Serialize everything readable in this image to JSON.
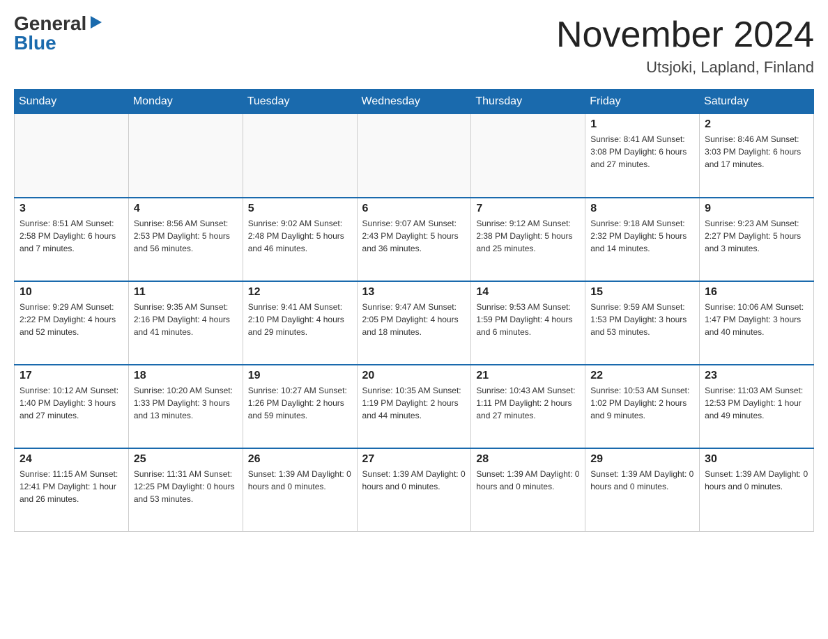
{
  "logo": {
    "general": "General",
    "blue": "Blue"
  },
  "header": {
    "month": "November 2024",
    "location": "Utsjoki, Lapland, Finland"
  },
  "days_of_week": [
    "Sunday",
    "Monday",
    "Tuesday",
    "Wednesday",
    "Thursday",
    "Friday",
    "Saturday"
  ],
  "weeks": [
    [
      {
        "day": "",
        "info": ""
      },
      {
        "day": "",
        "info": ""
      },
      {
        "day": "",
        "info": ""
      },
      {
        "day": "",
        "info": ""
      },
      {
        "day": "",
        "info": ""
      },
      {
        "day": "1",
        "info": "Sunrise: 8:41 AM\nSunset: 3:08 PM\nDaylight: 6 hours and 27 minutes."
      },
      {
        "day": "2",
        "info": "Sunrise: 8:46 AM\nSunset: 3:03 PM\nDaylight: 6 hours and 17 minutes."
      }
    ],
    [
      {
        "day": "3",
        "info": "Sunrise: 8:51 AM\nSunset: 2:58 PM\nDaylight: 6 hours and 7 minutes."
      },
      {
        "day": "4",
        "info": "Sunrise: 8:56 AM\nSunset: 2:53 PM\nDaylight: 5 hours and 56 minutes."
      },
      {
        "day": "5",
        "info": "Sunrise: 9:02 AM\nSunset: 2:48 PM\nDaylight: 5 hours and 46 minutes."
      },
      {
        "day": "6",
        "info": "Sunrise: 9:07 AM\nSunset: 2:43 PM\nDaylight: 5 hours and 36 minutes."
      },
      {
        "day": "7",
        "info": "Sunrise: 9:12 AM\nSunset: 2:38 PM\nDaylight: 5 hours and 25 minutes."
      },
      {
        "day": "8",
        "info": "Sunrise: 9:18 AM\nSunset: 2:32 PM\nDaylight: 5 hours and 14 minutes."
      },
      {
        "day": "9",
        "info": "Sunrise: 9:23 AM\nSunset: 2:27 PM\nDaylight: 5 hours and 3 minutes."
      }
    ],
    [
      {
        "day": "10",
        "info": "Sunrise: 9:29 AM\nSunset: 2:22 PM\nDaylight: 4 hours and 52 minutes."
      },
      {
        "day": "11",
        "info": "Sunrise: 9:35 AM\nSunset: 2:16 PM\nDaylight: 4 hours and 41 minutes."
      },
      {
        "day": "12",
        "info": "Sunrise: 9:41 AM\nSunset: 2:10 PM\nDaylight: 4 hours and 29 minutes."
      },
      {
        "day": "13",
        "info": "Sunrise: 9:47 AM\nSunset: 2:05 PM\nDaylight: 4 hours and 18 minutes."
      },
      {
        "day": "14",
        "info": "Sunrise: 9:53 AM\nSunset: 1:59 PM\nDaylight: 4 hours and 6 minutes."
      },
      {
        "day": "15",
        "info": "Sunrise: 9:59 AM\nSunset: 1:53 PM\nDaylight: 3 hours and 53 minutes."
      },
      {
        "day": "16",
        "info": "Sunrise: 10:06 AM\nSunset: 1:47 PM\nDaylight: 3 hours and 40 minutes."
      }
    ],
    [
      {
        "day": "17",
        "info": "Sunrise: 10:12 AM\nSunset: 1:40 PM\nDaylight: 3 hours and 27 minutes."
      },
      {
        "day": "18",
        "info": "Sunrise: 10:20 AM\nSunset: 1:33 PM\nDaylight: 3 hours and 13 minutes."
      },
      {
        "day": "19",
        "info": "Sunrise: 10:27 AM\nSunset: 1:26 PM\nDaylight: 2 hours and 59 minutes."
      },
      {
        "day": "20",
        "info": "Sunrise: 10:35 AM\nSunset: 1:19 PM\nDaylight: 2 hours and 44 minutes."
      },
      {
        "day": "21",
        "info": "Sunrise: 10:43 AM\nSunset: 1:11 PM\nDaylight: 2 hours and 27 minutes."
      },
      {
        "day": "22",
        "info": "Sunrise: 10:53 AM\nSunset: 1:02 PM\nDaylight: 2 hours and 9 minutes."
      },
      {
        "day": "23",
        "info": "Sunrise: 11:03 AM\nSunset: 12:53 PM\nDaylight: 1 hour and 49 minutes."
      }
    ],
    [
      {
        "day": "24",
        "info": "Sunrise: 11:15 AM\nSunset: 12:41 PM\nDaylight: 1 hour and 26 minutes."
      },
      {
        "day": "25",
        "info": "Sunrise: 11:31 AM\nSunset: 12:25 PM\nDaylight: 0 hours and 53 minutes."
      },
      {
        "day": "26",
        "info": "Sunset: 1:39 AM\nDaylight: 0 hours and 0 minutes."
      },
      {
        "day": "27",
        "info": "Sunset: 1:39 AM\nDaylight: 0 hours and 0 minutes."
      },
      {
        "day": "28",
        "info": "Sunset: 1:39 AM\nDaylight: 0 hours and 0 minutes."
      },
      {
        "day": "29",
        "info": "Sunset: 1:39 AM\nDaylight: 0 hours and 0 minutes."
      },
      {
        "day": "30",
        "info": "Sunset: 1:39 AM\nDaylight: 0 hours and 0 minutes."
      }
    ]
  ]
}
